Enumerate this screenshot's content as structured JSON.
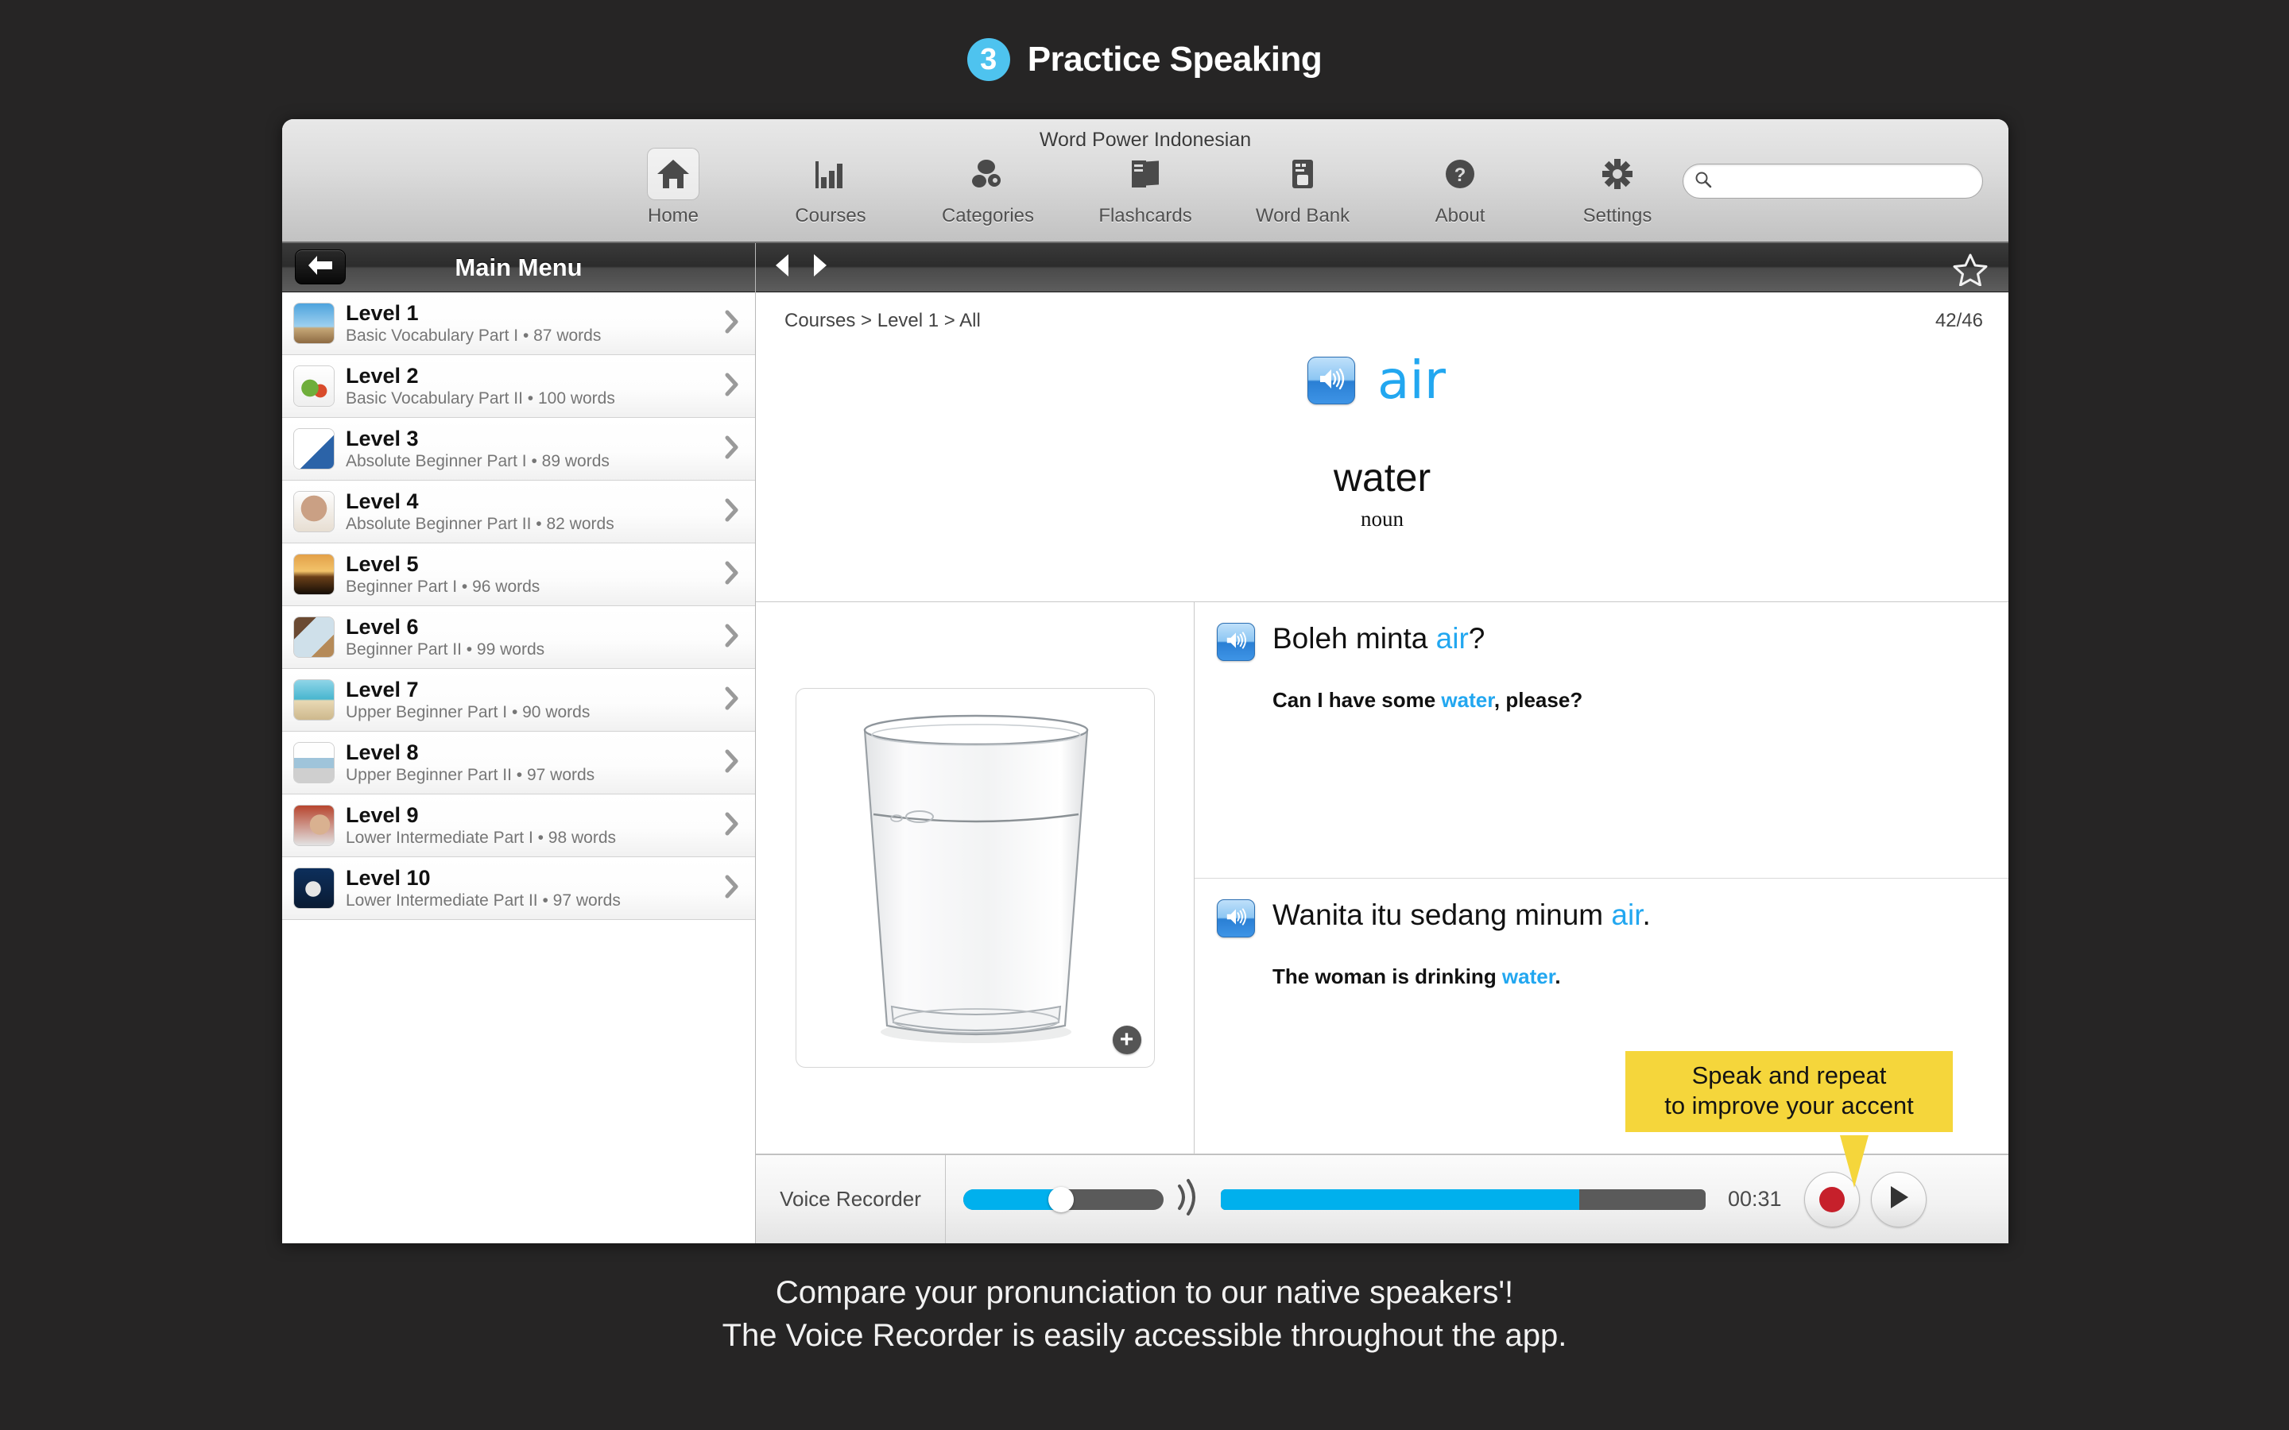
{
  "page": {
    "step_number": "3",
    "title": "Practice Speaking",
    "caption_line1": "Compare your pronunciation to our native speakers'!",
    "caption_line2": "The Voice Recorder is easily accessible throughout the app.",
    "accent_blue": "#22a7f0",
    "badge_blue": "#4ec3ef",
    "callout_yellow": "#f5d63b",
    "background": "#262525"
  },
  "window": {
    "title": "Word Power Indonesian"
  },
  "toolbar": {
    "items": [
      {
        "label": "Home",
        "icon": "home-icon",
        "active": true
      },
      {
        "label": "Courses",
        "icon": "bar-chart-icon",
        "active": false
      },
      {
        "label": "Categories",
        "icon": "categories-icon",
        "active": false
      },
      {
        "label": "Flashcards",
        "icon": "flashcards-icon",
        "active": false
      },
      {
        "label": "Word Bank",
        "icon": "word-bank-icon",
        "active": false
      },
      {
        "label": "About",
        "icon": "question-mark-icon",
        "active": false
      },
      {
        "label": "Settings",
        "icon": "gear-icon",
        "active": false
      }
    ],
    "search": {
      "value": "",
      "placeholder": "",
      "icon": "search-icon"
    }
  },
  "sidebar": {
    "header_title": "Main Menu",
    "back_icon": "back-arrow-icon",
    "levels": [
      {
        "name": "Level 1",
        "sub": "Basic Vocabulary Part I • 87 words",
        "thumb": "t-sky"
      },
      {
        "name": "Level 2",
        "sub": "Basic Vocabulary Part II • 100 words",
        "thumb": "t-veg"
      },
      {
        "name": "Level 3",
        "sub": "Absolute Beginner Part I • 89 words",
        "thumb": "t-key"
      },
      {
        "name": "Level 4",
        "sub": "Absolute Beginner Part II • 82 words",
        "thumb": "t-girl"
      },
      {
        "name": "Level 5",
        "sub": "Beginner Part I • 96 words",
        "thumb": "t-sun"
      },
      {
        "name": "Level 6",
        "sub": "Beginner Part II • 99 words",
        "thumb": "t-book"
      },
      {
        "name": "Level 7",
        "sub": "Upper Beginner Part I • 90 words",
        "thumb": "t-beach"
      },
      {
        "name": "Level 8",
        "sub": "Upper Beginner Part II • 97 words",
        "thumb": "t-laptop"
      },
      {
        "name": "Level 9",
        "sub": "Lower Intermediate Part I • 98 words",
        "thumb": "t-people"
      },
      {
        "name": "Level 10",
        "sub": "Lower Intermediate Part II • 97 words",
        "thumb": "t-run"
      }
    ]
  },
  "main": {
    "topbar": {
      "prev_icon": "previous-arrow-icon",
      "next_icon": "next-arrow-icon",
      "star_icon": "star-outline-icon"
    },
    "breadcrumb": "Courses > Level 1 > All",
    "counter": "42/46",
    "headword": "air",
    "headword_audio_icon": "speaker-icon",
    "translation": "water",
    "part_of_speech": "noun",
    "image": {
      "alt": "glass-of-water",
      "zoom_label": "+"
    },
    "sentences": [
      {
        "audio_icon": "speaker-icon",
        "target_before": "Boleh minta ",
        "target_highlight": "air",
        "target_after": "?",
        "translation_before": "Can I have some ",
        "translation_highlight": "water",
        "translation_after": ", please?"
      },
      {
        "audio_icon": "speaker-icon",
        "target_before": "Wanita itu sedang minum ",
        "target_highlight": "air",
        "target_after": ".",
        "translation_before": "The woman is drinking ",
        "translation_highlight": "water",
        "translation_after": "."
      }
    ]
  },
  "recorder": {
    "label": "Voice Recorder",
    "time": "00:31",
    "volume_percent": 49,
    "playback_percent": 74,
    "record_icon": "record-dot-icon",
    "play_icon": "play-triangle-icon",
    "volume_icon": "volume-waves-icon"
  },
  "callout": {
    "line1": "Speak and repeat",
    "line2": "to improve your accent"
  }
}
